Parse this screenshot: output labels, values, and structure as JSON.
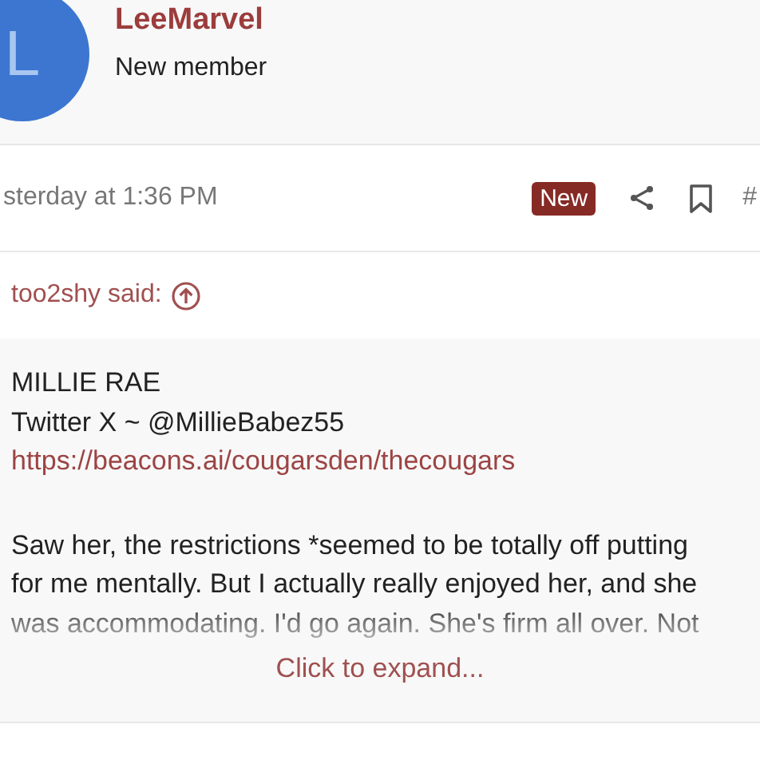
{
  "author": {
    "avatar_letter": "L",
    "name": "LeeMarvel",
    "title": "New member"
  },
  "meta": {
    "date": "sterday at 1:36 PM",
    "badge": "New",
    "post_number": "#"
  },
  "quote": {
    "attribution": "too2shy said:",
    "lines": [
      "MILLIE RAE",
      "Twitter X ~ @MillieBabez55"
    ],
    "link": "https://beacons.ai/cougarsden/thecougars",
    "body": "Saw her, the restrictions *seemed to be totally off putting for me mentally. But I actually really enjoyed her, and she was accommodating. I'd go again. She's firm all over. Not",
    "expand": "Click to expand..."
  }
}
